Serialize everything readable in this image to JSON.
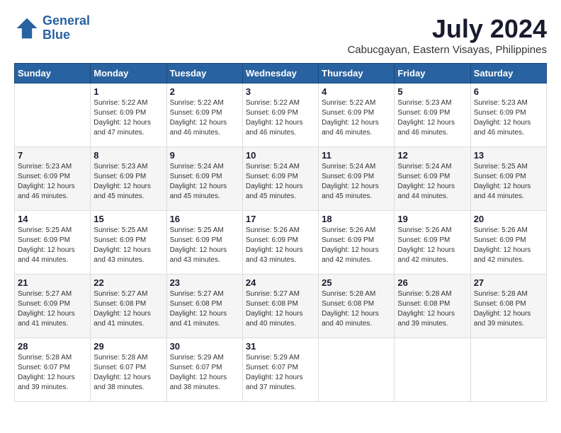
{
  "header": {
    "logo_line1": "General",
    "logo_line2": "Blue",
    "month_year": "July 2024",
    "location": "Cabucgayan, Eastern Visayas, Philippines"
  },
  "weekdays": [
    "Sunday",
    "Monday",
    "Tuesday",
    "Wednesday",
    "Thursday",
    "Friday",
    "Saturday"
  ],
  "weeks": [
    [
      {
        "day": "",
        "sunrise": "",
        "sunset": "",
        "daylight": ""
      },
      {
        "day": "1",
        "sunrise": "Sunrise: 5:22 AM",
        "sunset": "Sunset: 6:09 PM",
        "daylight": "Daylight: 12 hours and 47 minutes."
      },
      {
        "day": "2",
        "sunrise": "Sunrise: 5:22 AM",
        "sunset": "Sunset: 6:09 PM",
        "daylight": "Daylight: 12 hours and 46 minutes."
      },
      {
        "day": "3",
        "sunrise": "Sunrise: 5:22 AM",
        "sunset": "Sunset: 6:09 PM",
        "daylight": "Daylight: 12 hours and 46 minutes."
      },
      {
        "day": "4",
        "sunrise": "Sunrise: 5:22 AM",
        "sunset": "Sunset: 6:09 PM",
        "daylight": "Daylight: 12 hours and 46 minutes."
      },
      {
        "day": "5",
        "sunrise": "Sunrise: 5:23 AM",
        "sunset": "Sunset: 6:09 PM",
        "daylight": "Daylight: 12 hours and 46 minutes."
      },
      {
        "day": "6",
        "sunrise": "Sunrise: 5:23 AM",
        "sunset": "Sunset: 6:09 PM",
        "daylight": "Daylight: 12 hours and 46 minutes."
      }
    ],
    [
      {
        "day": "7",
        "sunrise": "Sunrise: 5:23 AM",
        "sunset": "Sunset: 6:09 PM",
        "daylight": "Daylight: 12 hours and 46 minutes."
      },
      {
        "day": "8",
        "sunrise": "Sunrise: 5:23 AM",
        "sunset": "Sunset: 6:09 PM",
        "daylight": "Daylight: 12 hours and 45 minutes."
      },
      {
        "day": "9",
        "sunrise": "Sunrise: 5:24 AM",
        "sunset": "Sunset: 6:09 PM",
        "daylight": "Daylight: 12 hours and 45 minutes."
      },
      {
        "day": "10",
        "sunrise": "Sunrise: 5:24 AM",
        "sunset": "Sunset: 6:09 PM",
        "daylight": "Daylight: 12 hours and 45 minutes."
      },
      {
        "day": "11",
        "sunrise": "Sunrise: 5:24 AM",
        "sunset": "Sunset: 6:09 PM",
        "daylight": "Daylight: 12 hours and 45 minutes."
      },
      {
        "day": "12",
        "sunrise": "Sunrise: 5:24 AM",
        "sunset": "Sunset: 6:09 PM",
        "daylight": "Daylight: 12 hours and 44 minutes."
      },
      {
        "day": "13",
        "sunrise": "Sunrise: 5:25 AM",
        "sunset": "Sunset: 6:09 PM",
        "daylight": "Daylight: 12 hours and 44 minutes."
      }
    ],
    [
      {
        "day": "14",
        "sunrise": "Sunrise: 5:25 AM",
        "sunset": "Sunset: 6:09 PM",
        "daylight": "Daylight: 12 hours and 44 minutes."
      },
      {
        "day": "15",
        "sunrise": "Sunrise: 5:25 AM",
        "sunset": "Sunset: 6:09 PM",
        "daylight": "Daylight: 12 hours and 43 minutes."
      },
      {
        "day": "16",
        "sunrise": "Sunrise: 5:25 AM",
        "sunset": "Sunset: 6:09 PM",
        "daylight": "Daylight: 12 hours and 43 minutes."
      },
      {
        "day": "17",
        "sunrise": "Sunrise: 5:26 AM",
        "sunset": "Sunset: 6:09 PM",
        "daylight": "Daylight: 12 hours and 43 minutes."
      },
      {
        "day": "18",
        "sunrise": "Sunrise: 5:26 AM",
        "sunset": "Sunset: 6:09 PM",
        "daylight": "Daylight: 12 hours and 42 minutes."
      },
      {
        "day": "19",
        "sunrise": "Sunrise: 5:26 AM",
        "sunset": "Sunset: 6:09 PM",
        "daylight": "Daylight: 12 hours and 42 minutes."
      },
      {
        "day": "20",
        "sunrise": "Sunrise: 5:26 AM",
        "sunset": "Sunset: 6:09 PM",
        "daylight": "Daylight: 12 hours and 42 minutes."
      }
    ],
    [
      {
        "day": "21",
        "sunrise": "Sunrise: 5:27 AM",
        "sunset": "Sunset: 6:09 PM",
        "daylight": "Daylight: 12 hours and 41 minutes."
      },
      {
        "day": "22",
        "sunrise": "Sunrise: 5:27 AM",
        "sunset": "Sunset: 6:08 PM",
        "daylight": "Daylight: 12 hours and 41 minutes."
      },
      {
        "day": "23",
        "sunrise": "Sunrise: 5:27 AM",
        "sunset": "Sunset: 6:08 PM",
        "daylight": "Daylight: 12 hours and 41 minutes."
      },
      {
        "day": "24",
        "sunrise": "Sunrise: 5:27 AM",
        "sunset": "Sunset: 6:08 PM",
        "daylight": "Daylight: 12 hours and 40 minutes."
      },
      {
        "day": "25",
        "sunrise": "Sunrise: 5:28 AM",
        "sunset": "Sunset: 6:08 PM",
        "daylight": "Daylight: 12 hours and 40 minutes."
      },
      {
        "day": "26",
        "sunrise": "Sunrise: 5:28 AM",
        "sunset": "Sunset: 6:08 PM",
        "daylight": "Daylight: 12 hours and 39 minutes."
      },
      {
        "day": "27",
        "sunrise": "Sunrise: 5:28 AM",
        "sunset": "Sunset: 6:08 PM",
        "daylight": "Daylight: 12 hours and 39 minutes."
      }
    ],
    [
      {
        "day": "28",
        "sunrise": "Sunrise: 5:28 AM",
        "sunset": "Sunset: 6:07 PM",
        "daylight": "Daylight: 12 hours and 39 minutes."
      },
      {
        "day": "29",
        "sunrise": "Sunrise: 5:28 AM",
        "sunset": "Sunset: 6:07 PM",
        "daylight": "Daylight: 12 hours and 38 minutes."
      },
      {
        "day": "30",
        "sunrise": "Sunrise: 5:29 AM",
        "sunset": "Sunset: 6:07 PM",
        "daylight": "Daylight: 12 hours and 38 minutes."
      },
      {
        "day": "31",
        "sunrise": "Sunrise: 5:29 AM",
        "sunset": "Sunset: 6:07 PM",
        "daylight": "Daylight: 12 hours and 37 minutes."
      },
      {
        "day": "",
        "sunrise": "",
        "sunset": "",
        "daylight": ""
      },
      {
        "day": "",
        "sunrise": "",
        "sunset": "",
        "daylight": ""
      },
      {
        "day": "",
        "sunrise": "",
        "sunset": "",
        "daylight": ""
      }
    ]
  ]
}
